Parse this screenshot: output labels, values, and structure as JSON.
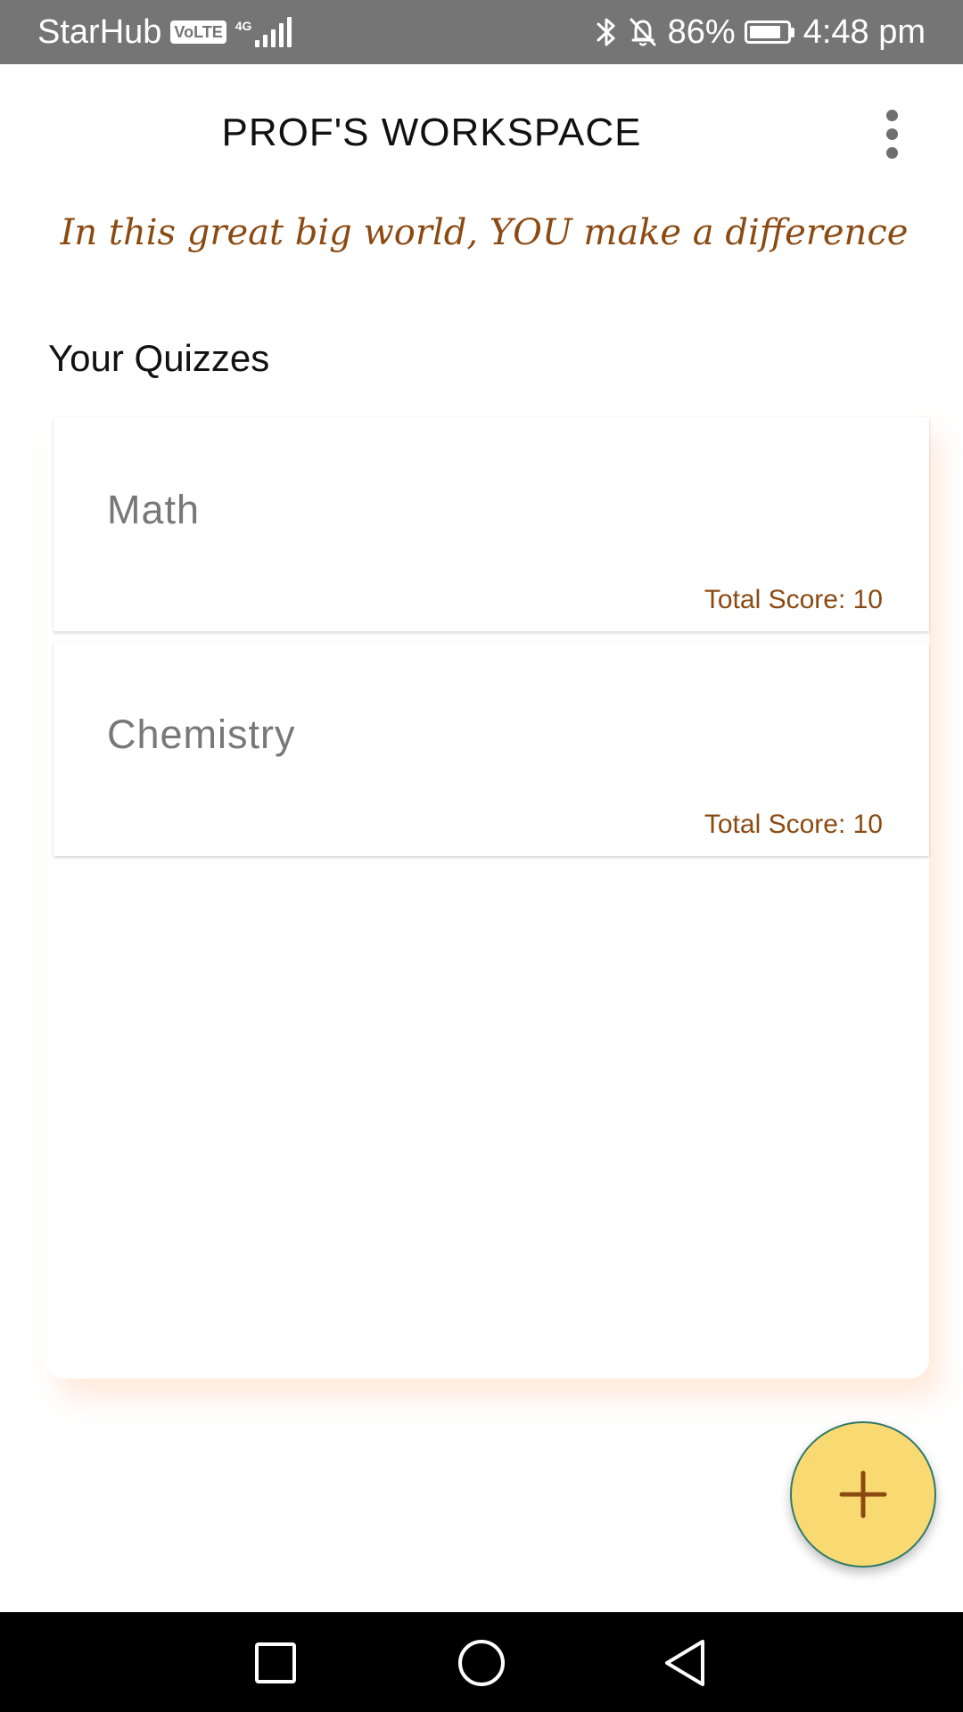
{
  "status_bar": {
    "carrier": "StarHub",
    "volte": "VoLTE",
    "network": "4G",
    "battery": "86%",
    "battery_level": 0.86,
    "time": "4:48 pm",
    "icons": [
      "volte-icon",
      "signal-icon",
      "bluetooth-icon",
      "bell-off-icon",
      "battery-icon"
    ]
  },
  "app_bar": {
    "title": "PROF'S WORKSPACE",
    "menu_icon": "more-vertical-icon"
  },
  "tagline": "In this great big world, YOU make a difference",
  "quizzes": {
    "title": "Your Quizzes",
    "items": [
      {
        "name": "Math",
        "score": "Total Score: 10"
      },
      {
        "name": "Chemistry",
        "score": "Total Score: 10"
      }
    ]
  },
  "fab": {
    "icon": "plus-icon"
  },
  "nav_bar": {
    "icons": [
      "square-recents-icon",
      "circle-home-icon",
      "triangle-back-icon"
    ]
  },
  "colors": {
    "status_bar": "#757575",
    "accent_brown": "#8b4a12",
    "fab_fill": "#f9da72",
    "fab_border": "#2f7a6a",
    "panel_glow": "#ffc8a5"
  }
}
